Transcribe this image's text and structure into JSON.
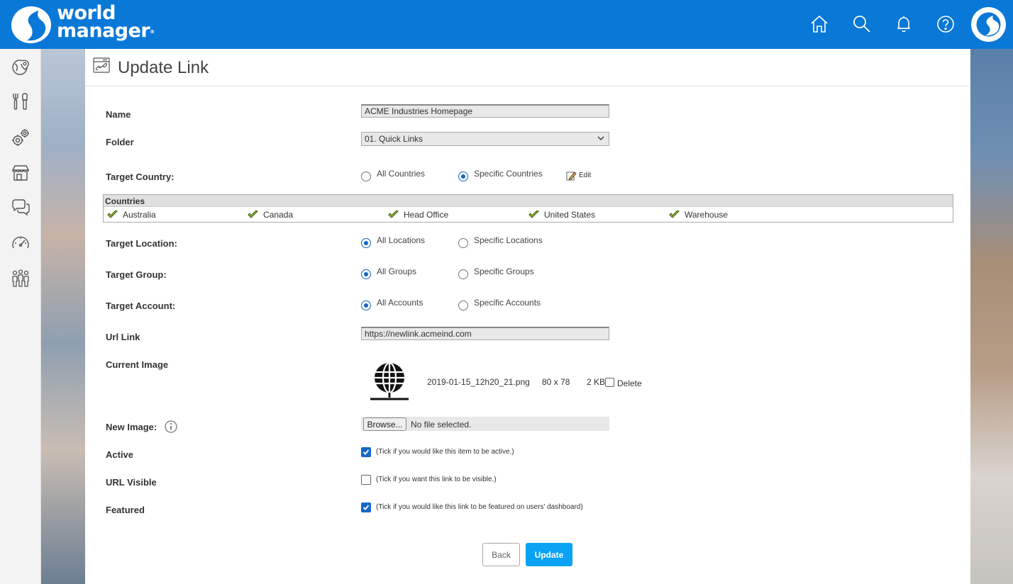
{
  "brand": {
    "name_line1": "world",
    "name_line2": "manager",
    "trademark": "®"
  },
  "header_icons": [
    "home-icon",
    "search-icon",
    "bell-icon",
    "help-icon"
  ],
  "sidebar_icons": [
    "globe-pin-icon",
    "tools-icon",
    "settings-icon",
    "store-icon",
    "chat-icon",
    "speedometer-icon",
    "people-icon"
  ],
  "page": {
    "title": "Update Link"
  },
  "form": {
    "name": {
      "label": "Name",
      "value": "ACME Industries Homepage"
    },
    "folder": {
      "label": "Folder",
      "value": "01. Quick Links"
    },
    "target_country": {
      "label": "Target Country:",
      "options": [
        "All Countries",
        "Specific Countries"
      ],
      "selected": "Specific Countries",
      "edit_label": "Edit"
    },
    "countries": {
      "header": "Countries",
      "items": [
        "Australia",
        "Canada",
        "Head Office",
        "United States",
        "Warehouse"
      ]
    },
    "target_location": {
      "label": "Target Location:",
      "options": [
        "All Locations",
        "Specific Locations"
      ],
      "selected": "All Locations"
    },
    "target_group": {
      "label": "Target Group:",
      "options": [
        "All Groups",
        "Specific Groups"
      ],
      "selected": "All Groups"
    },
    "target_account": {
      "label": "Target Account:",
      "options": [
        "All Accounts",
        "Specific Accounts"
      ],
      "selected": "All Accounts"
    },
    "url_link": {
      "label": "Url Link",
      "value": "https://newlink.acmeind.com"
    },
    "current_image": {
      "label": "Current Image",
      "filename": "2019-01-15_12h20_21.png",
      "dimensions": "80 x 78",
      "size": "2 KB",
      "delete_label": "Delete",
      "delete_checked": false
    },
    "new_image": {
      "label": "New Image:",
      "browse_label": "Browse...",
      "status": "No file selected."
    },
    "active": {
      "label": "Active",
      "checked": true,
      "hint": "(Tick if you would like this item to be active.)"
    },
    "url_visible": {
      "label": "URL Visible",
      "checked": false,
      "hint": "(Tick if you want this link to be visible.)"
    },
    "featured": {
      "label": "Featured",
      "checked": true,
      "hint": "(Tick if you would like this link to be featured on users' dashboard)"
    }
  },
  "actions": {
    "back_label": "Back",
    "update_label": "Update"
  },
  "colors": {
    "header": "#0a78d7",
    "primary_button": "#0aa2f4",
    "radio_selected": "#1565c0"
  }
}
